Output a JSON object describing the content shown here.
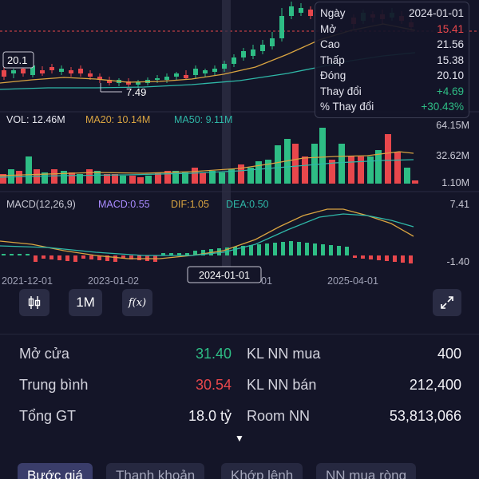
{
  "price_labels": {
    "left_value": "20.1",
    "low_marker": "7.49"
  },
  "volume_panel": {
    "vol_label": "VOL: 12.46M",
    "ma20_label": "MA20: 10.14M",
    "ma50_label": "MA50: 9.11M",
    "axis_top": "64.15M",
    "axis_mid": "32.62M",
    "axis_low": "1.10M"
  },
  "macd_panel": {
    "title": "MACD(12,26,9)",
    "macd_label": "MACD:0.55",
    "dif_label": "DIF:1.05",
    "dea_label": "DEA:0.50",
    "axis_top": "7.41",
    "axis_low": "-1.40"
  },
  "x_axis": [
    "2021-12-01",
    "2023-01-02",
    "2024-01-01",
    "2025-04-01"
  ],
  "crosshair_date": "2024-01-01",
  "tooltip": {
    "rows": [
      {
        "label": "Ngày",
        "value": "2024-01-01",
        "tone": "white"
      },
      {
        "label": "Mở",
        "value": "15.41",
        "tone": "red"
      },
      {
        "label": "Cao",
        "value": "21.56",
        "tone": "white"
      },
      {
        "label": "Thấp",
        "value": "15.38",
        "tone": "white"
      },
      {
        "label": "Đóng",
        "value": "20.10",
        "tone": "white"
      },
      {
        "label": "Thay đổi",
        "value": "+4.69",
        "tone": "green"
      },
      {
        "label": "% Thay đổi",
        "value": "+30.43%",
        "tone": "green"
      }
    ]
  },
  "toolbar": {
    "period_label": "1M",
    "fx_label": "f(x)"
  },
  "stats": {
    "open_label": "Mở cửa",
    "open_value": "31.40",
    "avg_label": "Trung bình",
    "avg_value": "30.54",
    "total_label": "Tổng GT",
    "total_value": "18.0 tỷ",
    "buy_label": "KL NN mua",
    "buy_value": "400",
    "sell_label": "KL NN bán",
    "sell_value": "212,400",
    "room_label": "Room NN",
    "room_value": "53,813,066"
  },
  "tabs": [
    "Bước giá",
    "Thanh khoản",
    "Khớp lệnh",
    "NN mua ròng"
  ],
  "colors": {
    "up": "#2ebd85",
    "down": "#e8474c",
    "ma20": "#d9a441",
    "ma50": "#2fb8a8",
    "macd_label": "#a98bff",
    "background": "#141528"
  },
  "chart_data": {
    "type": "candlestick",
    "interval": "1M",
    "price_labels": [
      20.1,
      7.49
    ],
    "volume": {
      "vol": "12.46M",
      "ma20": "10.14M",
      "ma50": "9.11M",
      "axis": [
        "64.15M",
        "32.62M",
        "1.10M"
      ]
    },
    "macd": {
      "params": "12,26,9",
      "macd": 0.55,
      "dif": 1.05,
      "dea": 0.5,
      "axis": [
        7.41,
        -1.4
      ]
    },
    "x_ticks": [
      "2021-12-01",
      "2023-01-02",
      "2024-01-01",
      "2025-04-01"
    ]
  }
}
